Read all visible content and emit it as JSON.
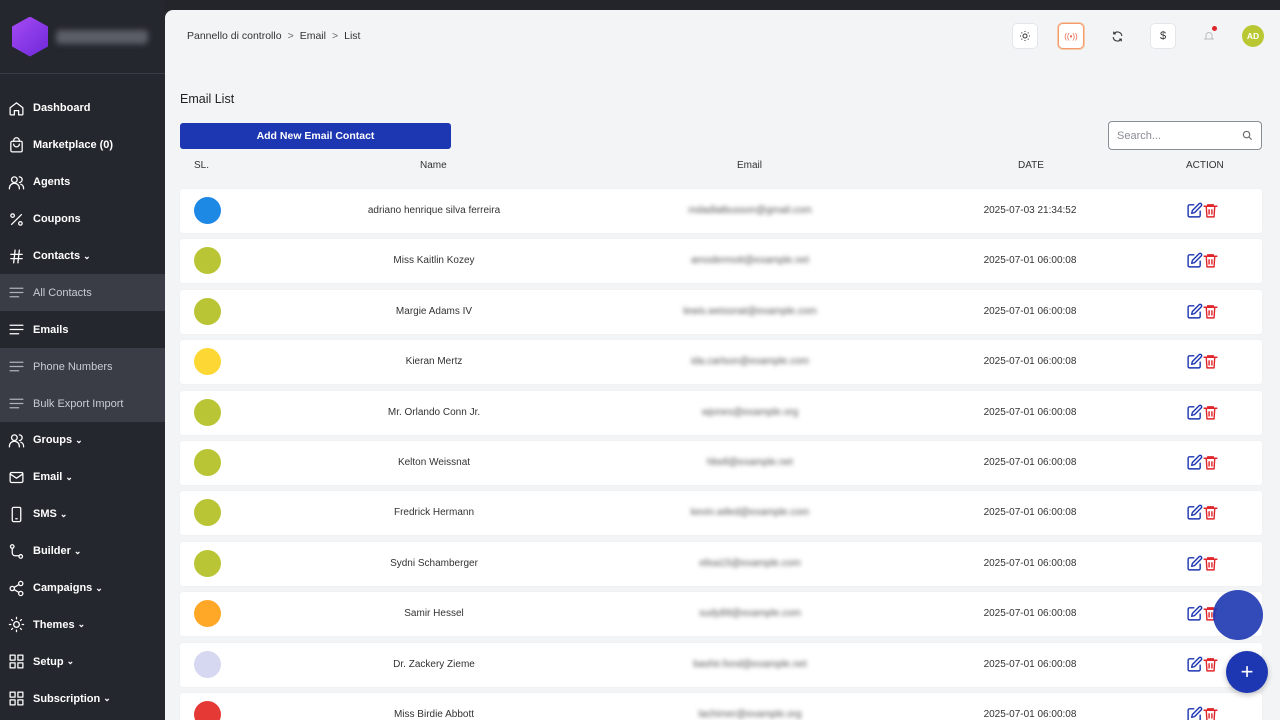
{
  "sidebar": {
    "items": [
      {
        "label": "Dashboard",
        "icon": "home-icon",
        "chevron": ""
      },
      {
        "label": "Marketplace (0)",
        "icon": "bag-icon",
        "chevron": ""
      },
      {
        "label": "Agents",
        "icon": "users-icon",
        "chevron": ""
      },
      {
        "label": "Coupons",
        "icon": "percent-icon",
        "chevron": ""
      },
      {
        "label": "Contacts",
        "icon": "hash-icon",
        "chevron": "⌄"
      },
      {
        "label": "All Contacts",
        "icon": "list-icon",
        "chevron": ""
      },
      {
        "label": "Emails",
        "icon": "list-icon",
        "chevron": ""
      },
      {
        "label": "Phone Numbers",
        "icon": "list-icon",
        "chevron": ""
      },
      {
        "label": "Bulk Export Import",
        "icon": "list-icon",
        "chevron": ""
      },
      {
        "label": "Groups",
        "icon": "users-icon",
        "chevron": "⌄"
      },
      {
        "label": "Email",
        "icon": "mail-icon",
        "chevron": "⌄"
      },
      {
        "label": "SMS",
        "icon": "phone-icon",
        "chevron": "⌄"
      },
      {
        "label": "Builder",
        "icon": "builder-icon",
        "chevron": "⌄"
      },
      {
        "label": "Campaigns",
        "icon": "share-icon",
        "chevron": "⌄"
      },
      {
        "label": "Themes",
        "icon": "sun-icon",
        "chevron": "⌄"
      },
      {
        "label": "Setup",
        "icon": "grid-icon",
        "chevron": "⌄"
      },
      {
        "label": "Subscription",
        "icon": "grid-icon",
        "chevron": "⌄"
      }
    ]
  },
  "header": {
    "breadcrumb": [
      "Pannello di controllo",
      "Email",
      "List"
    ],
    "breadcrumb_sep": ">",
    "icons": {
      "live": "((•))",
      "currency": "$"
    },
    "avatar": "AD"
  },
  "page": {
    "title": "Email List",
    "add_button": "Add New Email Contact",
    "search_placeholder": "Search..."
  },
  "table": {
    "columns": [
      "SL.",
      "Name",
      "Email",
      "DATE",
      "ACTION"
    ],
    "rows": [
      {
        "color": "#1e88e5",
        "name": "adriano henrique silva ferreira",
        "email": "mdadlatbusson@gmail.com",
        "date": "2025-07-03 21:34:52"
      },
      {
        "color": "#b9c535",
        "name": "Miss Kaitlin Kozey",
        "email": "amodermott@example.net",
        "date": "2025-07-01 06:00:08"
      },
      {
        "color": "#b9c535",
        "name": "Margie Adams IV",
        "email": "lewis.weissnat@example.com",
        "date": "2025-07-01 06:00:08"
      },
      {
        "color": "#fdd835",
        "name": "Kieran Mertz",
        "email": "ida.carlson@example.com",
        "date": "2025-07-01 06:00:08"
      },
      {
        "color": "#b9c535",
        "name": "Mr. Orlando Conn Jr.",
        "email": "wjones@example.org",
        "date": "2025-07-01 06:00:08"
      },
      {
        "color": "#b9c535",
        "name": "Kelton Weissnat",
        "email": "hbell@example.net",
        "date": "2025-07-01 06:00:08"
      },
      {
        "color": "#b9c535",
        "name": "Fredrick Hermann",
        "email": "kevin.wiled@example.com",
        "date": "2025-07-01 06:00:08"
      },
      {
        "color": "#b9c535",
        "name": "Sydni Schamberger",
        "email": "elisa15@example.com",
        "date": "2025-07-01 06:00:08"
      },
      {
        "color": "#ffa726",
        "name": "Samir Hessel",
        "email": "sudy89@example.com",
        "date": "2025-07-01 06:00:08"
      },
      {
        "color": "#d5d8f0",
        "name": "Dr. Zackery Zieme",
        "email": "bashir.fond@example.net",
        "date": "2025-07-01 06:00:08"
      },
      {
        "color": "#e53935",
        "name": "Miss Birdie Abbott",
        "email": "lachimer@example.org",
        "date": "2025-07-01 06:00:08"
      }
    ]
  },
  "fab": {
    "label": "+"
  },
  "colors": {
    "primary": "#1d36b1",
    "sidebar": "#25272e",
    "delete": "#e0262b",
    "edit": "#1d36b1"
  }
}
